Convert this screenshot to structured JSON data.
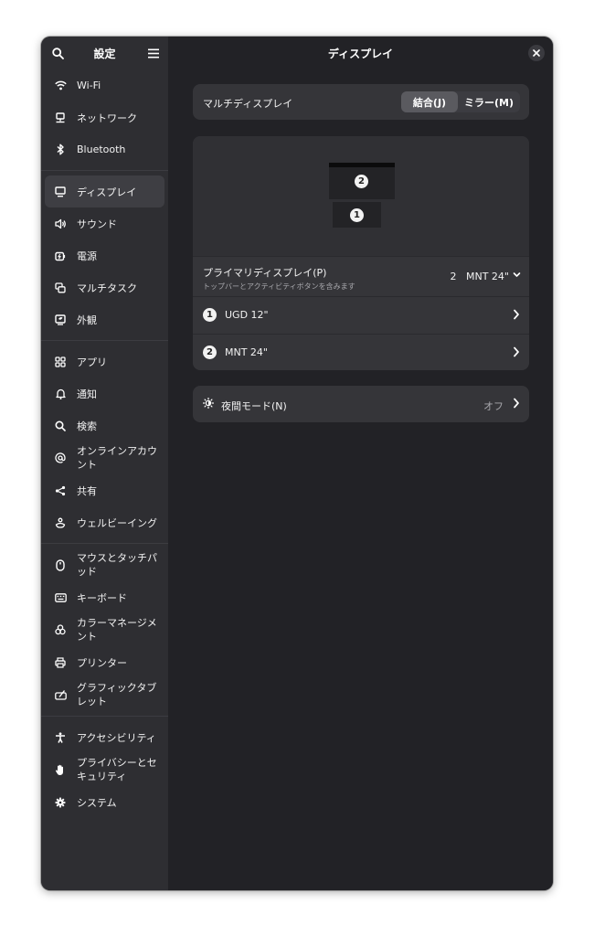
{
  "sidebar": {
    "title": "設定",
    "groups": [
      [
        {
          "label": "Wi-Fi",
          "icon": "wifi-icon"
        },
        {
          "label": "ネットワーク",
          "icon": "network-icon"
        },
        {
          "label": "Bluetooth",
          "icon": "bluetooth-icon"
        }
      ],
      [
        {
          "label": "ディスプレイ",
          "icon": "display-icon",
          "active": true
        },
        {
          "label": "サウンド",
          "icon": "sound-icon"
        },
        {
          "label": "電源",
          "icon": "power-icon"
        },
        {
          "label": "マルチタスク",
          "icon": "multitasking-icon"
        },
        {
          "label": "外観",
          "icon": "appearance-icon"
        }
      ],
      [
        {
          "label": "アプリ",
          "icon": "apps-icon"
        },
        {
          "label": "通知",
          "icon": "bell-icon"
        },
        {
          "label": "検索",
          "icon": "search-icon"
        },
        {
          "label": "オンラインアカウント",
          "icon": "at-icon"
        },
        {
          "label": "共有",
          "icon": "share-icon"
        },
        {
          "label": "ウェルビーイング",
          "icon": "wellbeing-icon"
        }
      ],
      [
        {
          "label": "マウスとタッチパッド",
          "icon": "mouse-icon"
        },
        {
          "label": "キーボード",
          "icon": "keyboard-icon"
        },
        {
          "label": "カラーマネージメント",
          "icon": "color-icon"
        },
        {
          "label": "プリンター",
          "icon": "printer-icon"
        },
        {
          "label": "グラフィックタブレット",
          "icon": "tablet-icon"
        }
      ],
      [
        {
          "label": "アクセシビリティ",
          "icon": "accessibility-icon"
        },
        {
          "label": "プライバシーとセキュリティ",
          "icon": "hand-icon"
        },
        {
          "label": "システム",
          "icon": "gear-icon"
        }
      ]
    ]
  },
  "main": {
    "title": "ディスプレイ",
    "multi_display": {
      "label": "マルチディスプレイ",
      "join_label": "結合(J)",
      "mirror_label": "ミラー(M)",
      "selected": "join"
    },
    "arrangement": {
      "monitor_top_badge": "2",
      "monitor_bottom_badge": "1"
    },
    "primary": {
      "title": "プライマリディスプレイ(P)",
      "subtitle": "トップバーとアクティビティボタンを含みます",
      "value_number": "2",
      "value_name": "MNT 24\""
    },
    "monitors": [
      {
        "badge": "1",
        "name": "UGD 12\""
      },
      {
        "badge": "2",
        "name": "MNT 24\""
      }
    ],
    "night_light": {
      "label": "夜間モード(N)",
      "value": "オフ"
    }
  }
}
